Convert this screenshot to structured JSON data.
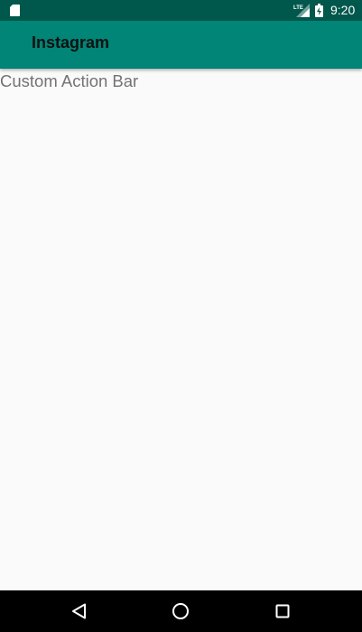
{
  "status_bar": {
    "time": "9:20",
    "network_label": "LTE",
    "icons": [
      "sd-card-icon",
      "lte-signal-icon",
      "battery-charging-icon"
    ]
  },
  "action_bar": {
    "title": "Instagram",
    "colors": {
      "background": "#008577",
      "status_bar": "#00574b"
    }
  },
  "content": {
    "text": "Custom Action Bar"
  },
  "nav_bar": {
    "buttons": [
      "back-icon",
      "home-icon",
      "recents-icon"
    ]
  }
}
